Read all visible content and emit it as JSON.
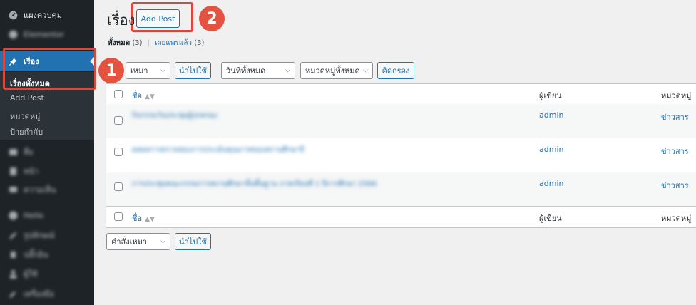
{
  "sidebar": {
    "dashboard_label": "แผงควบคุม",
    "blurred_top_label": "Elementor",
    "posts_label": "เรื่อง",
    "submenu": {
      "all_posts": "เรื่องทั้งหมด",
      "add_post": "Add Post",
      "categories": "หมวดหมู่",
      "tags": "ป้ายกำกับ"
    },
    "blurred_items": [
      "สื่อ",
      "หน้า",
      "ความเห็น",
      "Hello",
      "รูปลักษณ์",
      "ปลั๊กอิน",
      "ผู้ใช้",
      "เครื่องมือ"
    ]
  },
  "page": {
    "title": "เรื่อง",
    "add_button": "Add Post"
  },
  "filters": {
    "all_label": "ทั้งหมด",
    "all_count": "(3)",
    "separator": "|",
    "published_label": "เผยแพร่แล้ว",
    "published_count": "(3)"
  },
  "toolbar": {
    "bulk_action_top": "เหมา",
    "apply_top": "นำไปใช้",
    "dates_select": "วันที่ทั้งหมด",
    "category_select": "หมวดหมู่ทั้งหมด",
    "filter_button": "คัดกรอง",
    "bulk_action_bottom": "คำสั่งเหมา",
    "apply_bottom": "นำไปใช้"
  },
  "table": {
    "headers": {
      "title": "ชื่อ",
      "author": "ผู้เขียน",
      "category": "หมวดหมู่"
    },
    "rows": [
      {
        "title": "กิจกรรมวันประชุมผู้ปกครอง",
        "author": "admin",
        "category": "ข่าวสาร"
      },
      {
        "title": "ผลผลการตรวจสอบการประเมินคุณภาพของสถานศึกษาปี",
        "author": "admin",
        "category": "ข่าวสาร"
      },
      {
        "title": "การประชุมคณะกรรมการสถานศึกษาขั้นพื้นฐาน ภาคเรียนที่ 1 ปีการศึกษา 2566",
        "author": "admin",
        "category": "ข่าวสาร"
      }
    ]
  },
  "annotations": {
    "step1": "1",
    "step2": "2"
  },
  "colors": {
    "sidebar_bg": "#1d2327",
    "accent": "#2271b1",
    "highlight": "#e0453a"
  }
}
